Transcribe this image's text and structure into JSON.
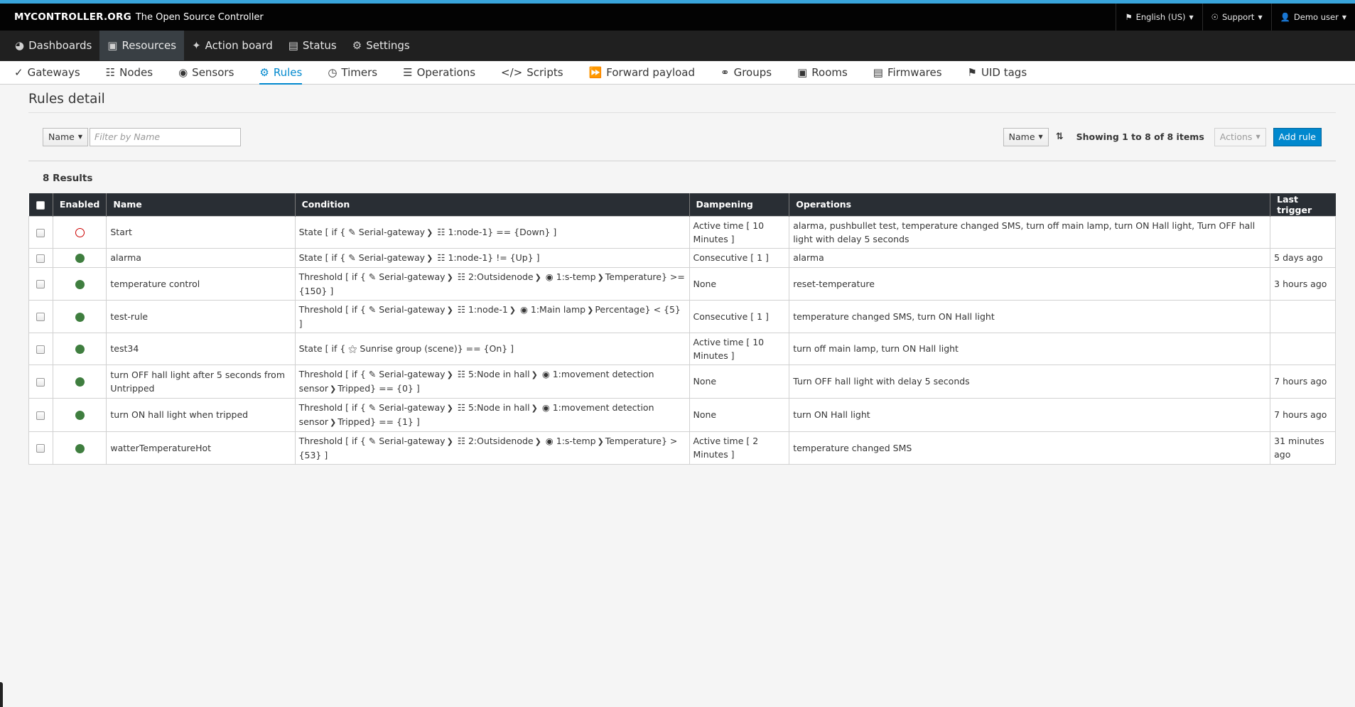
{
  "brand": {
    "name": "MYCONTROLLER.ORG",
    "tagline": "The Open Source Controller"
  },
  "utility": {
    "language": "English (US)",
    "support": "Support",
    "user": "Demo user"
  },
  "mainnav": [
    {
      "label": "Dashboards",
      "icon": "dashboard-icon"
    },
    {
      "label": "Resources",
      "icon": "cubes-icon"
    },
    {
      "label": "Action board",
      "icon": "magic-wand-icon"
    },
    {
      "label": "Status",
      "icon": "document-icon"
    },
    {
      "label": "Settings",
      "icon": "gear-icon"
    }
  ],
  "subnav": [
    {
      "label": "Gateways",
      "icon": "plug-icon"
    },
    {
      "label": "Nodes",
      "icon": "sitemap-icon"
    },
    {
      "label": "Sensors",
      "icon": "eye-icon"
    },
    {
      "label": "Rules",
      "icon": "cogs-icon"
    },
    {
      "label": "Timers",
      "icon": "clock-icon"
    },
    {
      "label": "Operations",
      "icon": "server-icon"
    },
    {
      "label": "Scripts",
      "icon": "code-icon"
    },
    {
      "label": "Forward payload",
      "icon": "fast-forward-icon"
    },
    {
      "label": "Groups",
      "icon": "group-icon"
    },
    {
      "label": "Rooms",
      "icon": "room-icon"
    },
    {
      "label": "Firmwares",
      "icon": "file-code-icon"
    },
    {
      "label": "UID tags",
      "icon": "tags-icon"
    }
  ],
  "page": {
    "title": "Rules detail"
  },
  "toolbar": {
    "filter_field": "Name",
    "filter_placeholder": "Filter by Name",
    "sort_field": "Name",
    "showing": "Showing 1 to 8 of 8 items",
    "actions": "Actions",
    "add_rule": "Add rule"
  },
  "results": "8 Results",
  "table": {
    "headers": {
      "enabled": "Enabled",
      "name": "Name",
      "condition": "Condition",
      "dampening": "Dampening",
      "operations": "Operations",
      "last_trigger": "Last trigger"
    },
    "rows": [
      {
        "enabled": false,
        "name": "Start",
        "condition": [
          "State [ if {",
          "plug",
          "Serial-gateway",
          ">",
          "sitemap",
          "1:node-1} == {Down} ]"
        ],
        "dampening": "Active time [ 10 Minutes ]",
        "operations": "alarma, pushbullet test, temperature changed SMS, turn off main lamp, turn ON Hall light, Turn OFF hall light with delay 5 seconds",
        "last_trigger": ""
      },
      {
        "enabled": true,
        "name": "alarma",
        "condition": [
          "State [ if {",
          "plug",
          "Serial-gateway",
          ">",
          "sitemap",
          "1:node-1} != {Up} ]"
        ],
        "dampening": "Consecutive [ 1 ]",
        "operations": "alarma",
        "last_trigger": "5 days ago"
      },
      {
        "enabled": true,
        "name": "temperature control",
        "condition": [
          "Threshold [ if {",
          "plug",
          "Serial-gateway",
          ">",
          "sitemap",
          "2:Outsidenode",
          ">",
          "eye",
          "1:s-temp",
          ">",
          "Temperature} >= {150} ]"
        ],
        "dampening": "None",
        "operations": "reset-temperature",
        "last_trigger": "3 hours ago"
      },
      {
        "enabled": true,
        "name": "test-rule",
        "condition": [
          "Threshold [ if {",
          "plug",
          "Serial-gateway",
          ">",
          "sitemap",
          "1:node-1",
          ">",
          "eye",
          "1:Main lamp",
          ">",
          "Percentage} < {5} ]"
        ],
        "dampening": "Consecutive [ 1 ]",
        "operations": "temperature changed SMS, turn ON Hall light",
        "last_trigger": ""
      },
      {
        "enabled": true,
        "name": "test34",
        "condition": [
          "State [ if {",
          "group",
          "Sunrise group (scene)} == {On} ]"
        ],
        "dampening": "Active time [ 10 Minutes ]",
        "operations": "turn off main lamp, turn ON Hall light",
        "last_trigger": ""
      },
      {
        "enabled": true,
        "name": "turn OFF hall light after 5 seconds from Untripped",
        "condition": [
          "Threshold [ if {",
          "plug",
          "Serial-gateway",
          ">",
          "sitemap",
          "5:Node in hall",
          ">",
          "eye",
          "1:movement detection sensor",
          ">",
          "Tripped} == {0} ]"
        ],
        "dampening": "None",
        "operations": "Turn OFF hall light with delay 5 seconds",
        "last_trigger": "7 hours ago"
      },
      {
        "enabled": true,
        "name": "turn ON hall light when tripped",
        "condition": [
          "Threshold [ if {",
          "plug",
          "Serial-gateway",
          ">",
          "sitemap",
          "5:Node in hall",
          ">",
          "eye",
          "1:movement detection sensor",
          ">",
          "Tripped} == {1} ]"
        ],
        "dampening": "None",
        "operations": "turn ON Hall light",
        "last_trigger": "7 hours ago"
      },
      {
        "enabled": true,
        "name": "watterTemperatureHot",
        "condition": [
          "Threshold [ if {",
          "plug",
          "Serial-gateway",
          ">",
          "sitemap",
          "2:Outsidenode",
          ">",
          "eye",
          "1:s-temp",
          ">",
          "Temperature} > {53} ]"
        ],
        "dampening": "Active time [ 2 Minutes ]",
        "operations": "temperature changed SMS",
        "last_trigger": "31 minutes ago"
      }
    ]
  },
  "colors": {
    "accent": "#0088ce",
    "enabled": "#3f7e3f",
    "disabled": "#cc0000",
    "header_bg": "#292e34",
    "masthead_bg": "#030303",
    "nav_bg": "#202020"
  }
}
